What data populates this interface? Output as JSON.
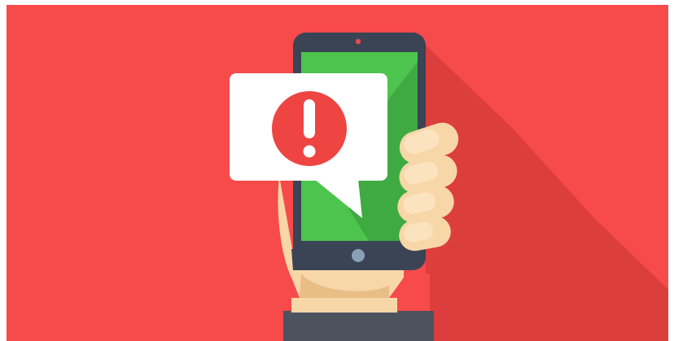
{
  "image": {
    "subject": "alert-notification-illustration",
    "icons": [
      "smartphone-icon",
      "exclamation-icon",
      "hand-icon",
      "speech-bubble-icon"
    ],
    "colors": {
      "background": "#f74a4a",
      "long_shadow": "#dc3d3d",
      "phone_body": "#3a4454",
      "screen": "#4cc44d",
      "screen_shadow": "#3eaa41",
      "bubble": "#ffffff",
      "alert_circle": "#ee4543",
      "skin": "#f7d6a8",
      "skin_shade": "#e9bd86",
      "sleeve": "#4c535f",
      "home_button": "#8aa0b7"
    }
  }
}
